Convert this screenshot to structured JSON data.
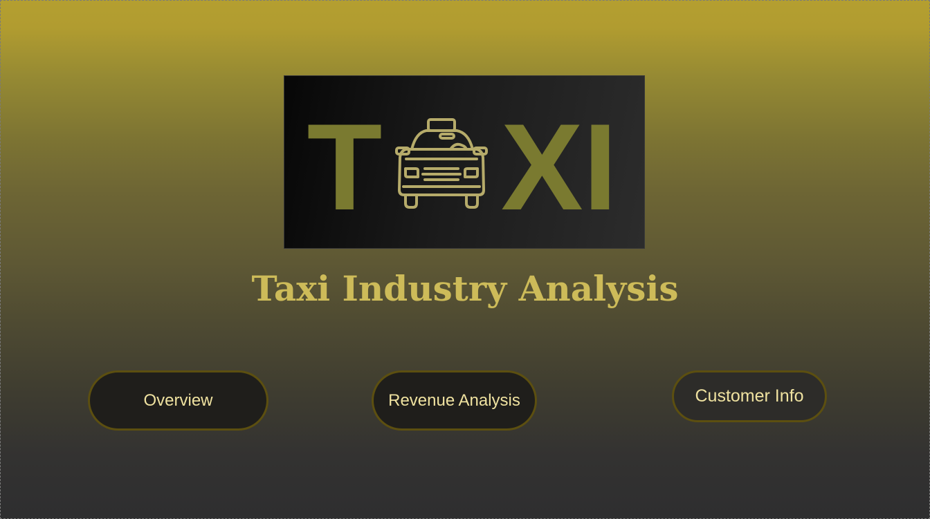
{
  "logo": {
    "letters_left": "T",
    "letters_right": "XI",
    "icon": "taxi-car-icon"
  },
  "title": "Taxi Industry Analysis",
  "nav": {
    "overview_label": "Overview",
    "revenue_label": "Revenue Analysis",
    "customer_label": "Customer Info"
  },
  "colors": {
    "accent_gold": "#cdbb59",
    "logo_olive": "#7a7a30",
    "car_outline": "#b6ab6a",
    "button_text": "#efe2a0",
    "button_border": "#5c4f10"
  }
}
